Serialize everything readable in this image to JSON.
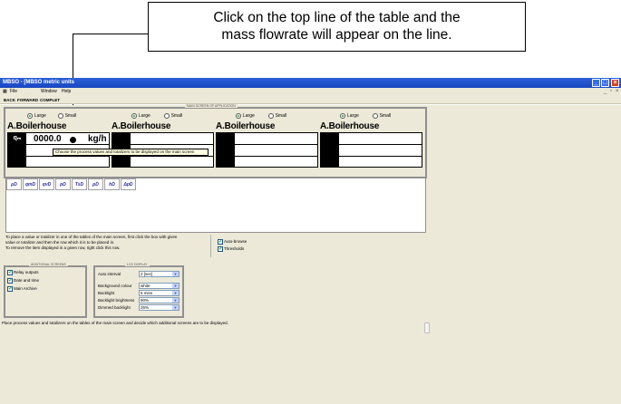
{
  "callout": {
    "line1": "Click on the top line of the table and the",
    "line2": "mass flowrate will appear on the line."
  },
  "window": {
    "title": "MBSO - [MBSO metric units",
    "menu": {
      "file": "File",
      "window": "Window",
      "help": "Help"
    },
    "toolbar": {
      "back": "BACK",
      "forward": "FORWARD",
      "complete": "COMPLET"
    }
  },
  "screens": {
    "frame_title": "MAIN SCREEN OF APPLICATION",
    "large_label": "Large",
    "small_label": "Small",
    "panels": [
      {
        "title": "A.Boilerhouse",
        "selected": "Large"
      },
      {
        "title": "A.Boilerhouse",
        "selected": "Large"
      },
      {
        "title": "A.Boilerhouse",
        "selected": "Large"
      },
      {
        "title": "A.Boilerhouse",
        "selected": "Large"
      }
    ],
    "first_row": {
      "tag": "qₘ",
      "value": "0000.0",
      "unit": "kg/h"
    },
    "tooltip": "Choose the process values and totalizers to be displayed on the main screen"
  },
  "palette": {
    "items": [
      "ρD",
      "qmD",
      "qvD",
      "pD",
      "TsD",
      "ρD",
      "hD",
      "ΔpD"
    ]
  },
  "instructions": {
    "line1": "To place a value or totalizer in one of the tables of the main screen, first click the box with given",
    "line2": "value or totalizer and then the row which it is to be placed in.",
    "line3": "To remove the item displayed in a given row, right click this row."
  },
  "options": {
    "auto_browse": {
      "label": "Auto-browse",
      "checked": true
    },
    "thresholds": {
      "label": "Thresholds",
      "checked": true
    }
  },
  "additional": {
    "title": "ADDITIONAL SCREENS",
    "items": [
      {
        "label": "Relay outputs",
        "checked": true
      },
      {
        "label": "Date and time",
        "checked": true
      },
      {
        "label": "Main Archive",
        "checked": true
      }
    ]
  },
  "lcd": {
    "title": "LCD DISPLAY",
    "auto_interval": {
      "label": "Auto interval",
      "value": "2 [sec]"
    },
    "bg_colour": {
      "label": "Background colour",
      "value": "white"
    },
    "backlight": {
      "label": "Backlight",
      "value": "5 mins"
    },
    "brightness": {
      "label": "Backlight brightness",
      "value": "90%"
    },
    "dimmed": {
      "label": "Dimmed backlight",
      "value": "25%"
    }
  },
  "footer": "Place process values and totalizers on the tables of the main screen and decide which additional screens are to be displayed."
}
